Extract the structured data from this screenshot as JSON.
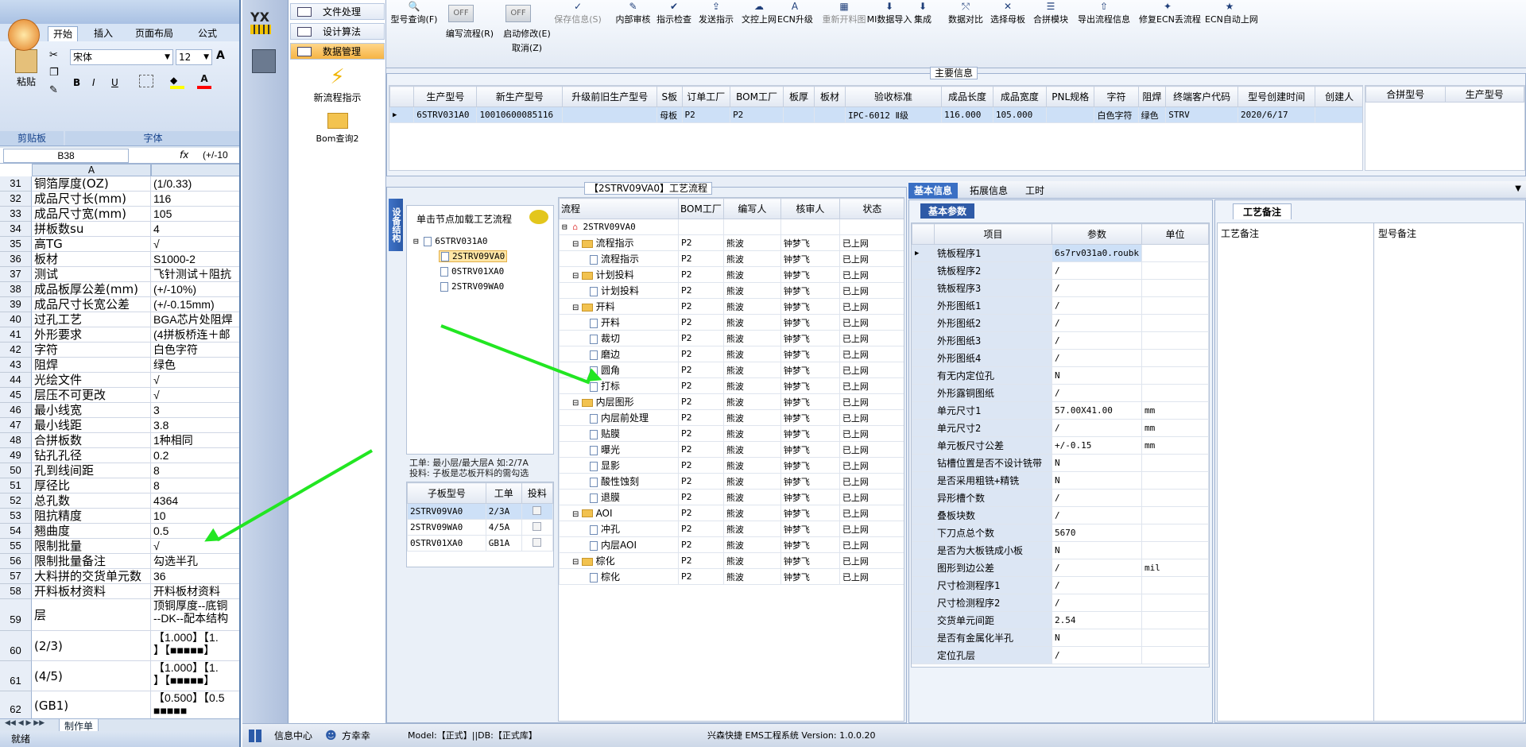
{
  "excel": {
    "tabs": [
      "开始",
      "插入",
      "页面布局",
      "公式"
    ],
    "clipboard": "剪贴板",
    "paste": "粘贴",
    "font_group": "字体",
    "font_name": "宋体",
    "font_size": "12",
    "name_box": "B38",
    "formula": "(+/-10",
    "col_a": "A",
    "rows": [
      {
        "n": "31",
        "a": "铜箔厚度(OZ)",
        "b": "(1/0.33)"
      },
      {
        "n": "32",
        "a": "成品尺寸长(mm)",
        "b": "116"
      },
      {
        "n": "33",
        "a": "成品尺寸宽(mm)",
        "b": "105"
      },
      {
        "n": "34",
        "a": "拼板数su",
        "b": "4"
      },
      {
        "n": "35",
        "a": "高TG",
        "b": "√"
      },
      {
        "n": "36",
        "a": "板材",
        "b": "S1000-2"
      },
      {
        "n": "37",
        "a": "测试",
        "b": "飞针测试＋阻抗"
      },
      {
        "n": "38",
        "a": "成品板厚公差(mm)",
        "b": "(+/-10%)"
      },
      {
        "n": "39",
        "a": "成品尺寸长宽公差",
        "b": "(+/-0.15mm)"
      },
      {
        "n": "40",
        "a": "过孔工艺",
        "b": "BGA芯片处阻焊"
      },
      {
        "n": "41",
        "a": "外形要求",
        "b": "(4拼板桥连＋邮"
      },
      {
        "n": "42",
        "a": "字符",
        "b": "白色字符"
      },
      {
        "n": "43",
        "a": "阻焊",
        "b": "绿色"
      },
      {
        "n": "44",
        "a": "光绘文件",
        "b": "√"
      },
      {
        "n": "45",
        "a": "层压不可更改",
        "b": "√"
      },
      {
        "n": "46",
        "a": "最小线宽",
        "b": "3"
      },
      {
        "n": "47",
        "a": "最小线距",
        "b": "3.8"
      },
      {
        "n": "48",
        "a": "合拼板数",
        "b": "1种相同"
      },
      {
        "n": "49",
        "a": "钻孔孔径",
        "b": "0.2"
      },
      {
        "n": "50",
        "a": "孔到线间距",
        "b": "8"
      },
      {
        "n": "51",
        "a": "厚径比",
        "b": "8"
      },
      {
        "n": "52",
        "a": "总孔数",
        "b": "4364"
      },
      {
        "n": "53",
        "a": "阻抗精度",
        "b": "10"
      },
      {
        "n": "54",
        "a": "翘曲度",
        "b": "0.5"
      },
      {
        "n": "55",
        "a": "限制批量",
        "b": "√"
      },
      {
        "n": "56",
        "a": "限制批量备注",
        "b": "勾选半孔"
      },
      {
        "n": "57",
        "a": "大料拼的交货单元数",
        "b": "36"
      },
      {
        "n": "58",
        "a": "开料板材资料",
        "b": "开料板材资料"
      }
    ],
    "row59": {
      "n": "59",
      "a": "层",
      "b1": "顶铜厚度--底铜",
      "b2": "--DK--配本结构"
    },
    "row60": {
      "n": "60",
      "a": "(2/3)",
      "b1": "【1.000】【1.",
      "b2": "】【■■■■■】"
    },
    "row61": {
      "n": "61",
      "a": "(4/5)",
      "b1": "【1.000】【1.",
      "b2": "】【■■■■■】"
    },
    "row62": {
      "n": "62",
      "a": "(GB1)",
      "b1": "【0.500】【0.5",
      "b2": "■■■■■"
    },
    "sheet_tab": "制作单",
    "status": "就绪"
  },
  "nav": {
    "items": [
      "文件处理",
      "设计算法",
      "数据管理"
    ],
    "big1": "新流程指示",
    "big2": "Bom查询2"
  },
  "toolbar": {
    "buttons": [
      "型号查询(F)",
      "编写流程(R)",
      "启动修改(E)",
      "取消(Z)",
      "保存信息(S)",
      "内部审核",
      "指示检查",
      "发送指示",
      "文控上网",
      "ECN升级",
      "重新开料图",
      "MI数据导入",
      "集成",
      "数据对比",
      "选择母板",
      "合拼模块",
      "导出流程信息",
      "修复ECN丢流程",
      "ECN自动上网"
    ],
    "off": "OFF"
  },
  "main_info": {
    "title": "主要信息",
    "headers": [
      "生产型号",
      "新生产型号",
      "升级前旧生产型号",
      "S板",
      "订单工厂",
      "BOM工厂",
      "板厚",
      "板材",
      "验收标准",
      "成品长度",
      "成品宽度",
      "PNL规格",
      "字符",
      "阻焊",
      "终端客户代码",
      "型号创建时间",
      "创建人"
    ],
    "row": [
      "6STRV031A0",
      "10010600085116",
      "",
      "母板",
      "P2",
      "P2",
      "",
      "",
      "IPC-6012 Ⅱ级",
      "116.000",
      "105.000",
      "",
      "白色字符",
      "绿色",
      "STRV",
      "2020/6/17",
      ""
    ],
    "right_headers": [
      "合拼型号",
      "生产型号"
    ]
  },
  "process": {
    "title": "【2STRV09VA0】工艺流程",
    "side_tab": "设备结构",
    "hint": "单击节点加载工艺流程",
    "tree_root": "6STRV031A0",
    "tree_children": [
      "2STRV09VA0",
      "0STRV01XA0",
      "2STRV09WA0"
    ],
    "note1": "工单: 最小层/最大层A 如:2/7A",
    "note2": "投料: 子板是芯板开料的需勾选",
    "sub_headers": [
      "子板型号",
      "工单",
      "投料"
    ],
    "sub_rows": [
      [
        "2STRV09VA0",
        "2/3A"
      ],
      [
        "2STRV09WA0",
        "4/5A"
      ],
      [
        "0STRV01XA0",
        "GB1A"
      ]
    ],
    "flow_headers": [
      "流程",
      "BOM工厂",
      "编写人",
      "核审人",
      "状态"
    ],
    "flow_root": "2STRV09VA0",
    "flow_rows": [
      {
        "name": "流程指示",
        "lvl": 1,
        "folder": true
      },
      {
        "name": "流程指示",
        "lvl": 2
      },
      {
        "name": "计划投料",
        "lvl": 1,
        "folder": true
      },
      {
        "name": "计划投料",
        "lvl": 2
      },
      {
        "name": "开料",
        "lvl": 1,
        "folder": true
      },
      {
        "name": "开料",
        "lvl": 2
      },
      {
        "name": "裁切",
        "lvl": 2
      },
      {
        "name": "磨边",
        "lvl": 2
      },
      {
        "name": "圆角",
        "lvl": 2
      },
      {
        "name": "打标",
        "lvl": 2
      },
      {
        "name": "内层图形",
        "lvl": 1,
        "folder": true
      },
      {
        "name": "内层前处理",
        "lvl": 2
      },
      {
        "name": "贴膜",
        "lvl": 2
      },
      {
        "name": "曝光",
        "lvl": 2
      },
      {
        "name": "显影",
        "lvl": 2
      },
      {
        "name": "酸性蚀刻",
        "lvl": 2
      },
      {
        "name": "退膜",
        "lvl": 2
      },
      {
        "name": "AOI",
        "lvl": 1,
        "folder": true
      },
      {
        "name": "冲孔",
        "lvl": 2
      },
      {
        "name": "内层AOI",
        "lvl": 2
      },
      {
        "name": "棕化",
        "lvl": 1,
        "folder": true
      },
      {
        "name": "棕化",
        "lvl": 2
      }
    ],
    "factory": "P2",
    "writer": "熊波",
    "reviewer": "钟梦飞",
    "state": "已上网"
  },
  "basic": {
    "tabs": [
      "基本信息",
      "拓展信息",
      "工时"
    ],
    "sub_tab": "基本参数",
    "headers": [
      "项目",
      "参数",
      "单位"
    ],
    "rows": [
      [
        "铣板程序1",
        "6s7rv031a0.roubk",
        ""
      ],
      [
        "铣板程序2",
        "/",
        ""
      ],
      [
        "铣板程序3",
        "/",
        ""
      ],
      [
        "外形图纸1",
        "/",
        ""
      ],
      [
        "外形图纸2",
        "/",
        ""
      ],
      [
        "外形图纸3",
        "/",
        ""
      ],
      [
        "外形图纸4",
        "/",
        ""
      ],
      [
        "有无内定位孔",
        "N",
        ""
      ],
      [
        "外形露铜图纸",
        "/",
        ""
      ],
      [
        "单元尺寸1",
        "57.00X41.00",
        "mm"
      ],
      [
        "单元尺寸2",
        "/",
        "mm"
      ],
      [
        "单元板尺寸公差",
        "+/-0.15",
        "mm"
      ],
      [
        "钻槽位置是否不设计铣带",
        "N",
        ""
      ],
      [
        "是否采用粗铣+精铣",
        "N",
        ""
      ],
      [
        "异形槽个数",
        "/",
        ""
      ],
      [
        "叠板块数",
        "/",
        ""
      ],
      [
        "下刀点总个数",
        "5670",
        ""
      ],
      [
        "是否为大板铣成小板",
        "N",
        ""
      ],
      [
        "图形到边公差",
        "/",
        "mil"
      ],
      [
        "尺寸检测程序1",
        "/",
        ""
      ],
      [
        "尺寸检测程序2",
        "/",
        ""
      ],
      [
        "交货单元间距",
        "2.54",
        ""
      ],
      [
        "是否有金属化半孔",
        "N",
        ""
      ],
      [
        "定位孔层",
        "/",
        ""
      ]
    ]
  },
  "remarks": {
    "tab": "工艺备注",
    "h1": "工艺备注",
    "h2": "型号备注"
  },
  "statusbar": {
    "info": "信息中心",
    "user": "方幸幸",
    "model": "Model:【正式】||DB:【正式库】",
    "system": "兴森快捷 EMS工程系统 Version: 1.0.0.20"
  }
}
